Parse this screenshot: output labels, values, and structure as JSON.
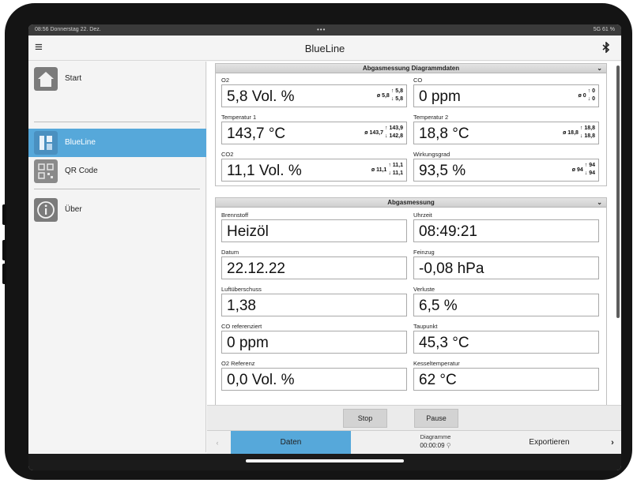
{
  "status": {
    "time": "08:56  Donnerstag 22. Dez.",
    "dots": "•••",
    "right": "5G 61 %"
  },
  "nav": {
    "title": "BlueLine",
    "menu_icon": "hamburger-icon",
    "bt_icon": "bluetooth-icon"
  },
  "sidebar": {
    "items": [
      {
        "label": "Start",
        "icon": "house-icon"
      },
      {
        "label": "BlueLine",
        "icon": "device-icon"
      },
      {
        "label": "QR Code",
        "icon": "qr-code-icon"
      },
      {
        "label": "Über",
        "icon": "info-icon"
      }
    ],
    "accent": "#56a8da"
  },
  "panel1": {
    "title": "Abgasmessung Diagrammdaten",
    "cells": [
      {
        "label": "O2",
        "value": "5,8 Vol. %",
        "avg": "ø 5,8",
        "max": "↑ 5,8",
        "min": "↓ 5,8"
      },
      {
        "label": "CO",
        "value": "0 ppm",
        "avg": "ø 0",
        "max": "↑ 0",
        "min": "↓ 0"
      },
      {
        "label": "Temperatur 1",
        "value": "143,7 °C",
        "avg": "ø 143,7",
        "max": "↑ 143,9",
        "min": "↓ 142,8"
      },
      {
        "label": "Temperatur 2",
        "value": "18,8 °C",
        "avg": "ø 18,8",
        "max": "↑ 18,8",
        "min": "↓ 18,8"
      },
      {
        "label": "CO2",
        "value": "11,1 Vol. %",
        "avg": "ø 11,1",
        "max": "↑ 11,1",
        "min": "↓ 11,1"
      },
      {
        "label": "Wirkungsgrad",
        "value": "93,5 %",
        "avg": "ø 94",
        "max": "↑ 94",
        "min": "↓ 94"
      }
    ]
  },
  "panel2": {
    "title": "Abgasmessung",
    "cells": [
      {
        "label": "Brennstoff",
        "value": "Heizöl"
      },
      {
        "label": "Uhrzeit",
        "value": "08:49:21"
      },
      {
        "label": "Datum",
        "value": "22.12.22"
      },
      {
        "label": "Feinzug",
        "value": "-0,08 hPa"
      },
      {
        "label": "Luftüberschuss",
        "value": "1,38"
      },
      {
        "label": "Verluste",
        "value": "6,5 %"
      },
      {
        "label": "CO referenziert",
        "value": "0 ppm"
      },
      {
        "label": "Taupunkt",
        "value": "45,3 °C"
      },
      {
        "label": "O2 Referenz",
        "value": "0,0 Vol. %"
      },
      {
        "label": "Kesseltemperatur",
        "value": "62 °C"
      }
    ]
  },
  "toolbar": {
    "stop": "Stop",
    "pause": "Pause"
  },
  "bottom": {
    "left": "‹",
    "daten": "Daten",
    "diagramme": "Diagramme",
    "timer": "00:00:09",
    "export": "Exportieren",
    "right": "›"
  }
}
